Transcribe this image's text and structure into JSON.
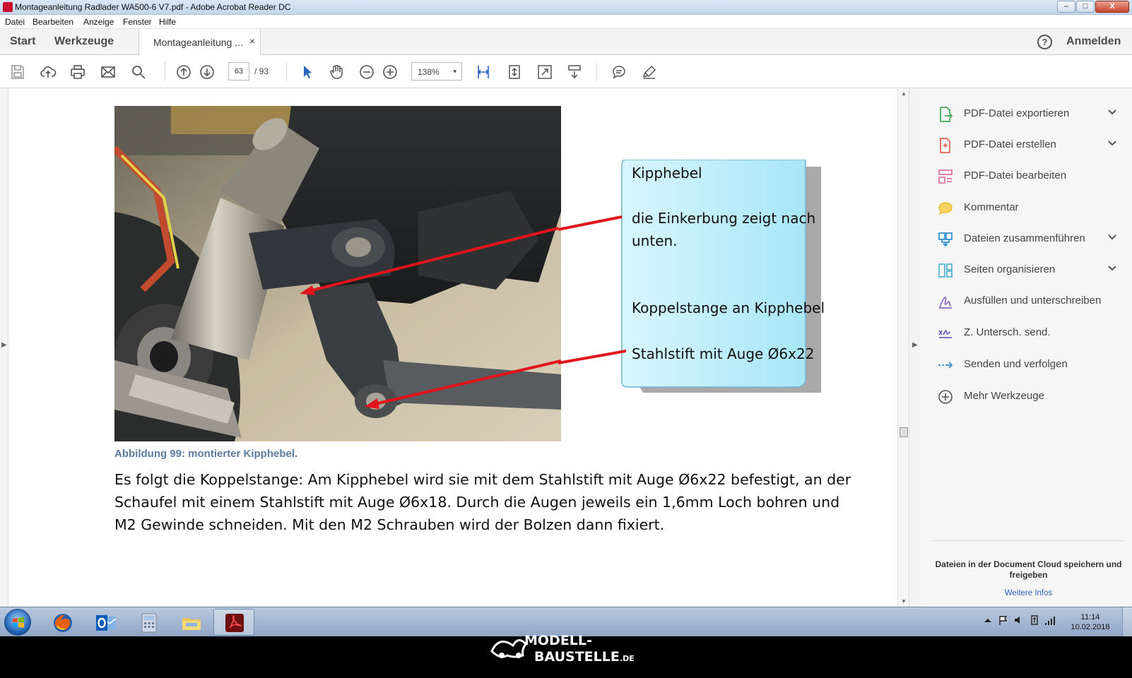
{
  "window": {
    "title": "Montageanleitung Radlader WA500-6 V7.pdf - Adobe Acrobat Reader DC",
    "controls": {
      "minimize": "‒",
      "maximize": "□",
      "close": "X"
    }
  },
  "menu": [
    "Datei",
    "Bearbeiten",
    "Anzeige",
    "Fenster",
    "Hilfe"
  ],
  "tabs": {
    "home": "Start",
    "tools": "Werkzeuge",
    "document": "Montageanleitung ...",
    "close": "×",
    "help": "?",
    "sign_in": "Anmelden"
  },
  "toolbar": {
    "page_current": "63",
    "page_total": "/ 93",
    "zoom": "138%",
    "zoom_caret": "▾"
  },
  "document": {
    "callout": {
      "title": "Kipphebel",
      "line1": "die Einkerbung zeigt nach",
      "line2": "unten.",
      "line3": "Koppelstange an Kipphebel",
      "line4": "Stahlstift mit Auge Ø6x22"
    },
    "caption": "Abbildung 99: montierter Kipphebel.",
    "body": [
      "Es folgt die Koppelstange: Am Kipphebel wird sie mit dem Stahlstift mit Auge Ø6x22 befestigt, an der",
      "Schaufel mit einem Stahlstift mit Auge Ø6x18. Durch die Augen jeweils ein 1,6mm Loch bohren und",
      "M2 Gewinde schneiden. Mit den M2 Schrauben wird der Bolzen dann fixiert."
    ]
  },
  "scroll": {
    "up": "▲",
    "down": "▼",
    "left_arrow": "▶",
    "panel_arrow": "▶"
  },
  "tools_pane": {
    "items": [
      {
        "label": "PDF-Datei exportieren",
        "icon": "export-pdf-icon",
        "expandable": true,
        "color": "#3fa64f"
      },
      {
        "label": "PDF-Datei erstellen",
        "icon": "create-pdf-icon",
        "expandable": true,
        "color": "#e0604e"
      },
      {
        "label": "PDF-Datei bearbeiten",
        "icon": "edit-pdf-icon",
        "expandable": false,
        "color": "#e46c9a"
      },
      {
        "label": "Kommentar",
        "icon": "comment-icon",
        "expandable": false,
        "color": "#f2c12e"
      },
      {
        "label": "Dateien zusammenführen",
        "icon": "combine-files-icon",
        "expandable": true,
        "color": "#2a8fd6"
      },
      {
        "label": "Seiten organisieren",
        "icon": "organize-pages-icon",
        "expandable": true,
        "color": "#4fb3cc"
      },
      {
        "label": "Ausfüllen und unterschreiben",
        "icon": "fill-sign-icon",
        "expandable": false,
        "color": "#8b6bc7"
      },
      {
        "label": "Z. Untersch. send.",
        "icon": "send-for-signature-icon",
        "expandable": false,
        "color": "#6f5fc2"
      },
      {
        "label": "Senden und verfolgen",
        "icon": "send-track-icon",
        "expandable": false,
        "color": "#3a8fd1"
      },
      {
        "label": "Mehr Werkzeuge",
        "icon": "more-tools-icon",
        "expandable": false,
        "color": "#555555"
      }
    ],
    "cloud_text": "Dateien in der Document Cloud speichern und freigeben",
    "cloud_link": "Weitere Infos"
  },
  "taskbar": {
    "apps": [
      "firefox-icon",
      "outlook-icon",
      "calculator-icon",
      "explorer-icon",
      "acrobat-icon"
    ],
    "active_app": "acrobat-icon",
    "clock_time": "11:14",
    "clock_date": "10.02.2018"
  },
  "watermark": {
    "line1": "MODELL-",
    "line2": "BAUSTELLE",
    "suffix": ".DE"
  }
}
